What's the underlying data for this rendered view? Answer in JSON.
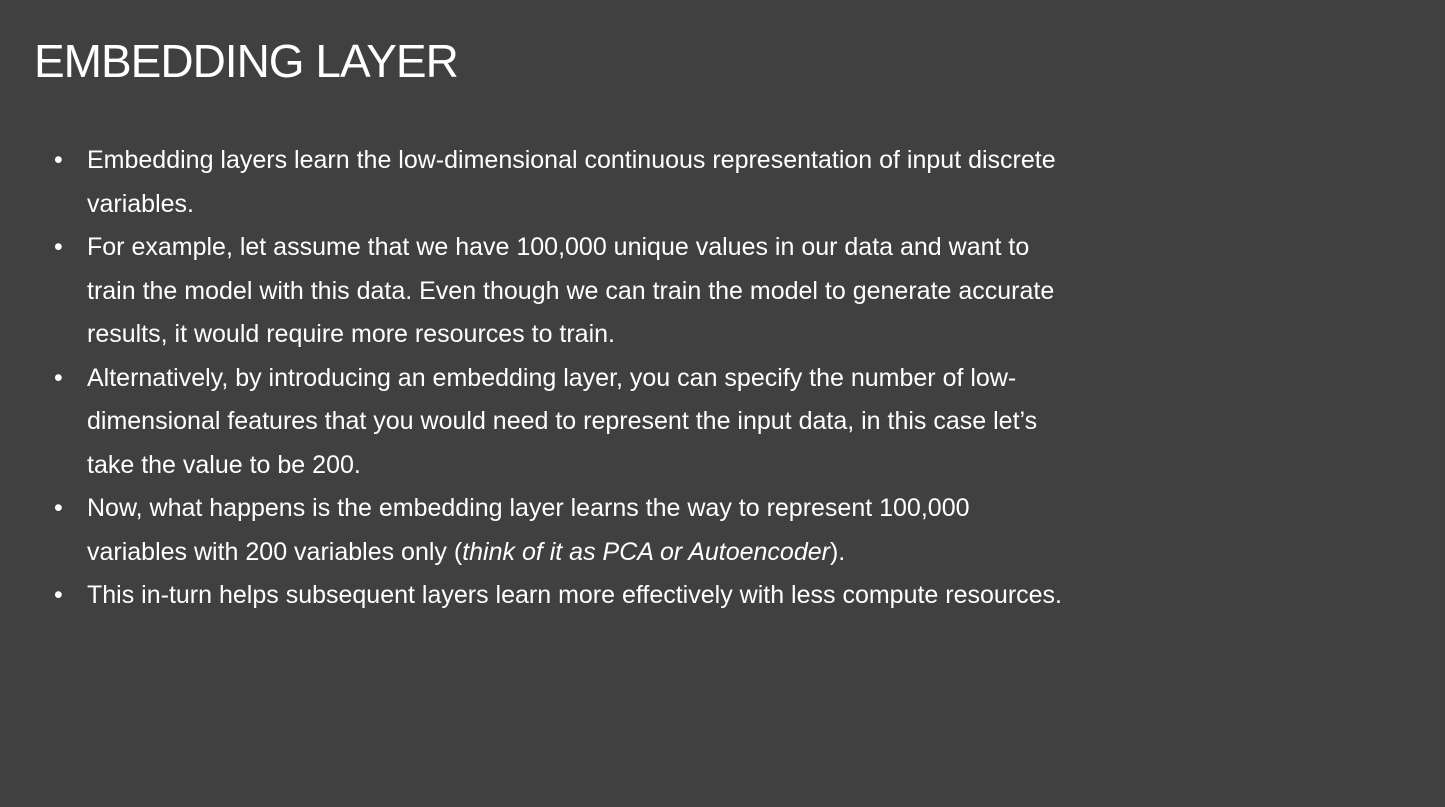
{
  "slide": {
    "title": "EMBEDDING LAYER",
    "bullet_symbol": "•",
    "bullets": [
      {
        "lines": [
          "Embedding layers learn the low-dimensional continuous representation of input discrete",
          "variables."
        ]
      },
      {
        "lines": [
          "For example, let assume that we have 100,000 unique values in our data and want to",
          "train the model with this data. Even though we can train the model to generate accurate",
          "results, it would require more resources to train."
        ]
      },
      {
        "lines": [
          "Alternatively, by introducing an embedding layer, you can specify the number of low-",
          "dimensional features that you would need to represent the input data, in this case let’s",
          "take the value to be 200."
        ]
      },
      {
        "lines": [
          "Now, what happens is the embedding layer learns the way to represent 100,000"
        ],
        "line2": {
          "before": "variables with 200 variables only (",
          "italic": "think of it as PCA or Autoencoder",
          "after": ")."
        }
      },
      {
        "lines": [
          "This in-turn helps subsequent layers learn more effectively with less compute resources."
        ]
      }
    ]
  },
  "colors": {
    "background": "#404040",
    "text": "#ffffff"
  }
}
